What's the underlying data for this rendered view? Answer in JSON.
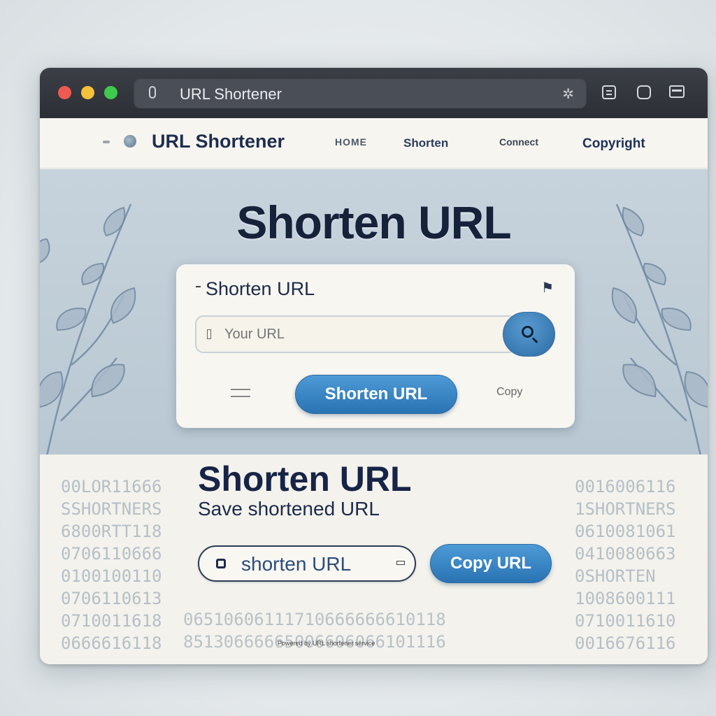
{
  "browser": {
    "tab_title": "URL Shortener",
    "traffic_lights": {
      "close": "#ee5a52",
      "minimize": "#f5c13a",
      "zoom": "#3fc94d"
    },
    "extension_icon": "puzzle-icon",
    "toolbar_icons": [
      "tabs-icon",
      "bookmark-icon",
      "sidebar-icon"
    ]
  },
  "navbar": {
    "brand": "URL Shortener",
    "links": [
      "HOME",
      "Shorten",
      "Connect",
      "Copyright"
    ]
  },
  "hero": {
    "title": "Shorten URL",
    "card": {
      "title": "Shorten URL",
      "input_placeholder": "Your URL",
      "search_icon": "search-icon",
      "submit_label": "Shorten URL",
      "left_icon": "menu-icon",
      "right_label": "Copy"
    }
  },
  "result": {
    "title": "Shorten URL",
    "subtitle": "Save shortened URL",
    "short_url": "shorten URL",
    "copy_label": "Copy URL",
    "footnote": "Powered by URL shortener service",
    "binary_left": [
      "00LOR11666",
      "SSHORTNERS",
      "6800RTT118",
      "0706110666",
      "0100100110",
      "0706110613",
      "0710011618",
      "0666616118"
    ],
    "binary_right": [
      "0016006116",
      "1SHORTNERS",
      "0610081061",
      "0410080663",
      "0SHORTEN",
      "1008600111",
      "0710011610",
      "0016676116"
    ],
    "binary_bottom": [
      "06510606111710666666610118",
      "85130666665006606066101116"
    ]
  },
  "colors": {
    "accent": "#2a73b3",
    "title_text": "#172447",
    "hero_bg": "#c7d3dc"
  }
}
